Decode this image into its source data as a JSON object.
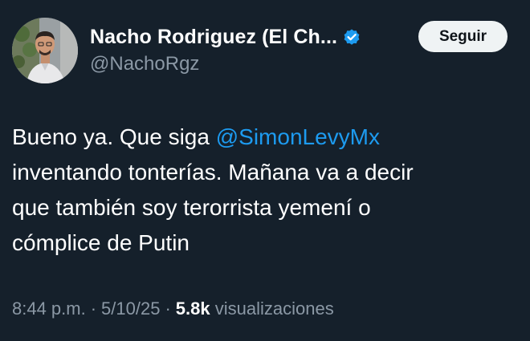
{
  "author": {
    "display_name": "Nacho Rodriguez (El Ch...",
    "handle": "@NachoRgz",
    "verified": true
  },
  "follow_button": {
    "label": "Seguir"
  },
  "tweet": {
    "text_lines": [
      {
        "before": "Bueno ya. Que siga ",
        "mention": "@SimonLevyMx"
      },
      {
        "text": "inventando tonterías. Mañana va a decir"
      },
      {
        "text": "que también soy terorrista yemení o"
      },
      {
        "text": "cómplice de Putin"
      }
    ]
  },
  "meta": {
    "time": "8:44 p.m.",
    "separator": "·",
    "date": "5/10/25",
    "views_count": "5.8k",
    "views_label": "visualizaciones"
  },
  "colors": {
    "background": "#15202b",
    "text": "#ffffff",
    "secondary_text": "#8b98a5",
    "link": "#1d9bf0",
    "verified_badge": "#1d9bf0",
    "follow_button_bg": "#eff3f4"
  },
  "icons": {
    "verified": "verified-badge-icon",
    "avatar": "profile-photo"
  }
}
